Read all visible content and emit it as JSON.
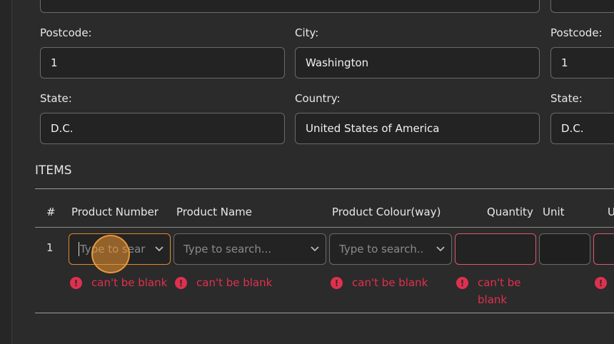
{
  "address_left": {
    "postcode_label": "Postcode:",
    "postcode_value": "1",
    "city_label": "City:",
    "city_value": "Washington",
    "state_label": "State:",
    "state_value": "D.C.",
    "country_label": "Country:",
    "country_value": "United States of America"
  },
  "address_right": {
    "postcode_label": "Postcode:",
    "postcode_value": "1",
    "state_label": "State:",
    "state_value": "D.C."
  },
  "items": {
    "title": "ITEMS",
    "columns": {
      "num": "#",
      "product_number": "Product Number",
      "product_name": "Product Name",
      "product_colour": "Product Colour(way)",
      "quantity": "Quantity",
      "unit": "Unit",
      "unit_price_partial": "U"
    },
    "row": {
      "num": "1",
      "product_number_placeholder": "Type to sear",
      "product_name_placeholder": "Type to search...",
      "product_colour_placeholder": "Type to search..",
      "error_text": "can't be blank",
      "quantity_error_line1": "can't be",
      "quantity_error_line2": "blank"
    }
  },
  "colors": {
    "error": "#e0304f",
    "focus": "#e08a2c",
    "background": "#2b2b2b"
  }
}
